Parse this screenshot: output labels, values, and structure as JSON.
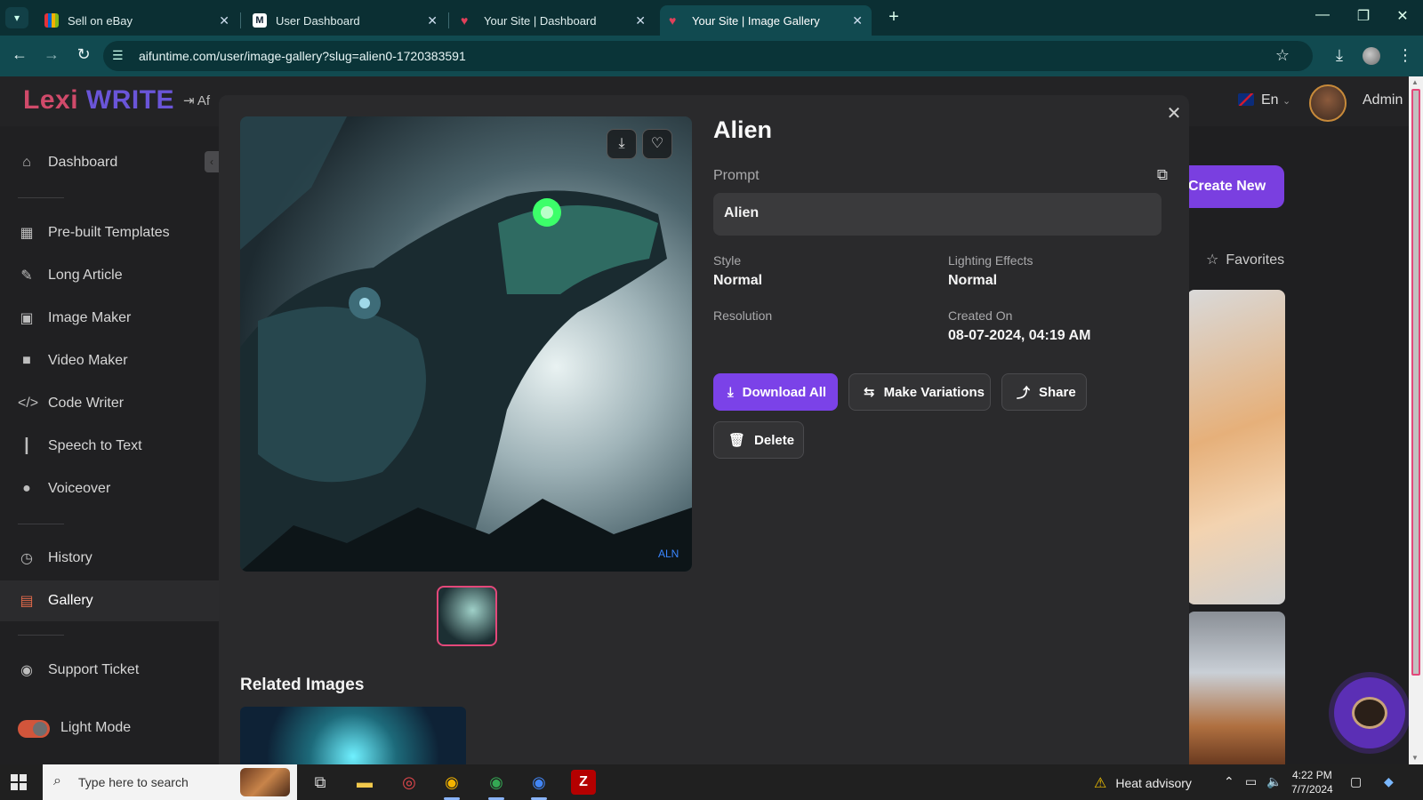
{
  "browser": {
    "tabs": [
      {
        "title": "Sell on eBay",
        "active": false
      },
      {
        "title": "User Dashboard",
        "active": false
      },
      {
        "title": "Your Site | Dashboard",
        "active": false
      },
      {
        "title": "Your Site | Image Gallery",
        "active": true
      }
    ],
    "new_tab": "+",
    "url": "aifuntime.com/user/image-gallery?slug=alien0-1720383591"
  },
  "header": {
    "logo_lexi": "Lexi",
    "logo_write": "WRITE",
    "affiliate_partial": "Af",
    "language": "En",
    "user": "Admin"
  },
  "sidebar": {
    "items": [
      {
        "label": "Dashboard",
        "icon": "home-icon"
      },
      {
        "label": "Pre-built Templates",
        "icon": "grid-icon"
      },
      {
        "label": "Long Article",
        "icon": "pen-icon"
      },
      {
        "label": "Image Maker",
        "icon": "image-icon"
      },
      {
        "label": "Video Maker",
        "icon": "video-icon"
      },
      {
        "label": "Code Writer",
        "icon": "code-icon"
      },
      {
        "label": "Speech to Text",
        "icon": "waveform-icon"
      },
      {
        "label": "Voiceover",
        "icon": "mic-icon"
      },
      {
        "label": "History",
        "icon": "history-icon"
      },
      {
        "label": "Gallery",
        "icon": "gallery-icon",
        "active": true
      },
      {
        "label": "Support Ticket",
        "icon": "support-icon"
      }
    ],
    "light_mode_label": "Light Mode"
  },
  "background_page": {
    "create_button": "Create New",
    "favorites_label": "Favorites"
  },
  "modal": {
    "title": "Alien",
    "prompt_label": "Prompt",
    "prompt_value": "Alien",
    "style_label": "Style",
    "style_value": "Normal",
    "lighting_label": "Lighting Effects",
    "lighting_value": "Normal",
    "resolution_label": "Resolution",
    "created_label": "Created On",
    "created_value": "08-07-2024, 04:19 AM",
    "buttons": {
      "download_all": "Download All",
      "make_variations": "Make Variations",
      "share": "Share",
      "delete": "Delete"
    },
    "related_title": "Related Images",
    "image_watermark": "ALN"
  },
  "taskbar": {
    "search_placeholder": "Type here to search",
    "weather": "Heat advisory",
    "time": "4:22 PM",
    "date": "7/7/2024"
  },
  "colors": {
    "accent": "#7b42e8",
    "logo_red": "#d04a6a",
    "logo_purple": "#6a55d8",
    "browser_teal": "#114a50"
  }
}
